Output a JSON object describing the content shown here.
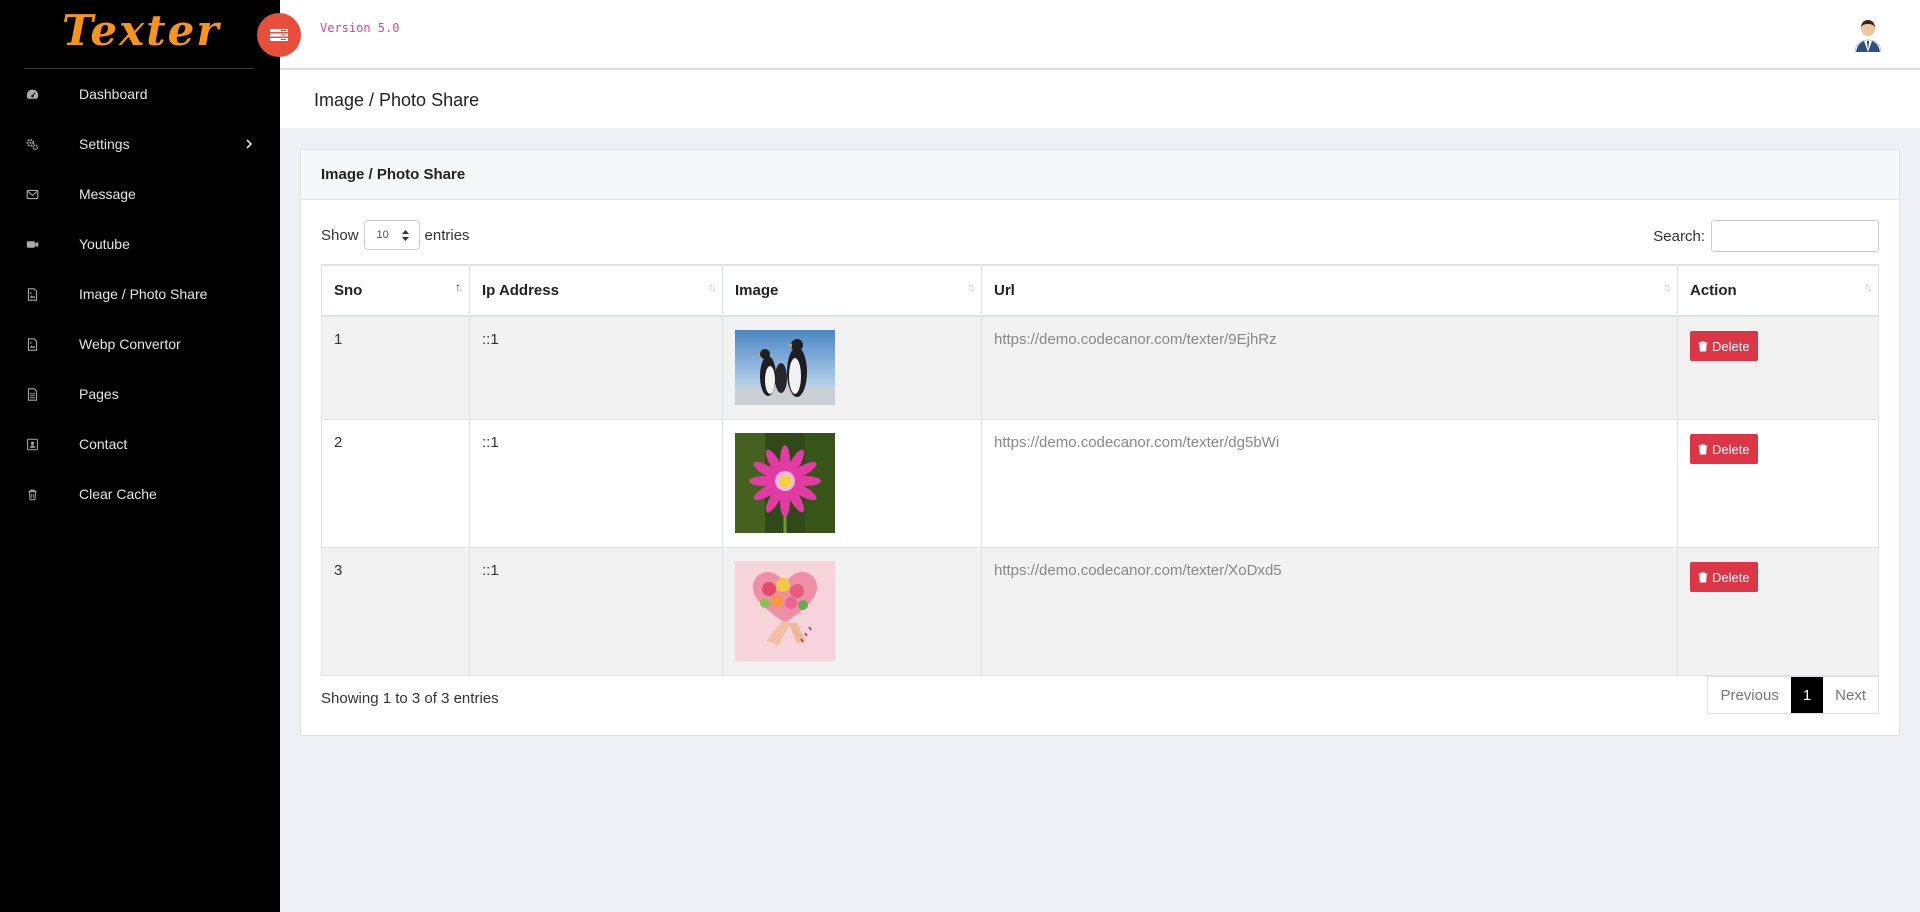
{
  "app": {
    "logo": "Texter",
    "version": "Version 5.0"
  },
  "sidebar": {
    "items": [
      {
        "label": "Dashboard",
        "icon": "dashboard-icon"
      },
      {
        "label": "Settings",
        "icon": "cogs-icon"
      },
      {
        "label": "Message",
        "icon": "envelope-icon"
      },
      {
        "label": "Youtube",
        "icon": "video-camera-icon"
      },
      {
        "label": "Image / Photo Share",
        "icon": "image-file-icon"
      },
      {
        "label": "Webp Convertor",
        "icon": "image-file-icon"
      },
      {
        "label": "Pages",
        "icon": "document-icon"
      },
      {
        "label": "Contact",
        "icon": "contact-card-icon"
      },
      {
        "label": "Clear Cache",
        "icon": "trash-icon"
      }
    ]
  },
  "page": {
    "title": "Image / Photo Share"
  },
  "card": {
    "title": "Image / Photo Share",
    "show_label": "Show",
    "entries_label": "entries",
    "page_length": "10",
    "search_label": "Search:",
    "search_value": ""
  },
  "table": {
    "columns": [
      "Sno",
      "Ip Address",
      "Image",
      "Url",
      "Action"
    ],
    "rows": [
      {
        "sno": "1",
        "ip": "::1",
        "image": "penguins-photo",
        "url": "https://demo.codecanor.com/texter/9EjhRz",
        "action": "Delete"
      },
      {
        "sno": "2",
        "ip": "::1",
        "image": "pink-flower-photo",
        "url": "https://demo.codecanor.com/texter/dg5bWi",
        "action": "Delete"
      },
      {
        "sno": "3",
        "ip": "::1",
        "image": "heart-bouquet-photo",
        "url": "https://demo.codecanor.com/texter/XoDxd5",
        "action": "Delete"
      }
    ]
  },
  "footer": {
    "showing": "Showing 1 to 3 of 3 entries",
    "prev": "Previous",
    "page": "1",
    "next": "Next"
  },
  "colors": {
    "accent": "#f7941d",
    "toggle": "#e94e3c",
    "danger": "#dc3545",
    "version": "#e83e8c"
  }
}
